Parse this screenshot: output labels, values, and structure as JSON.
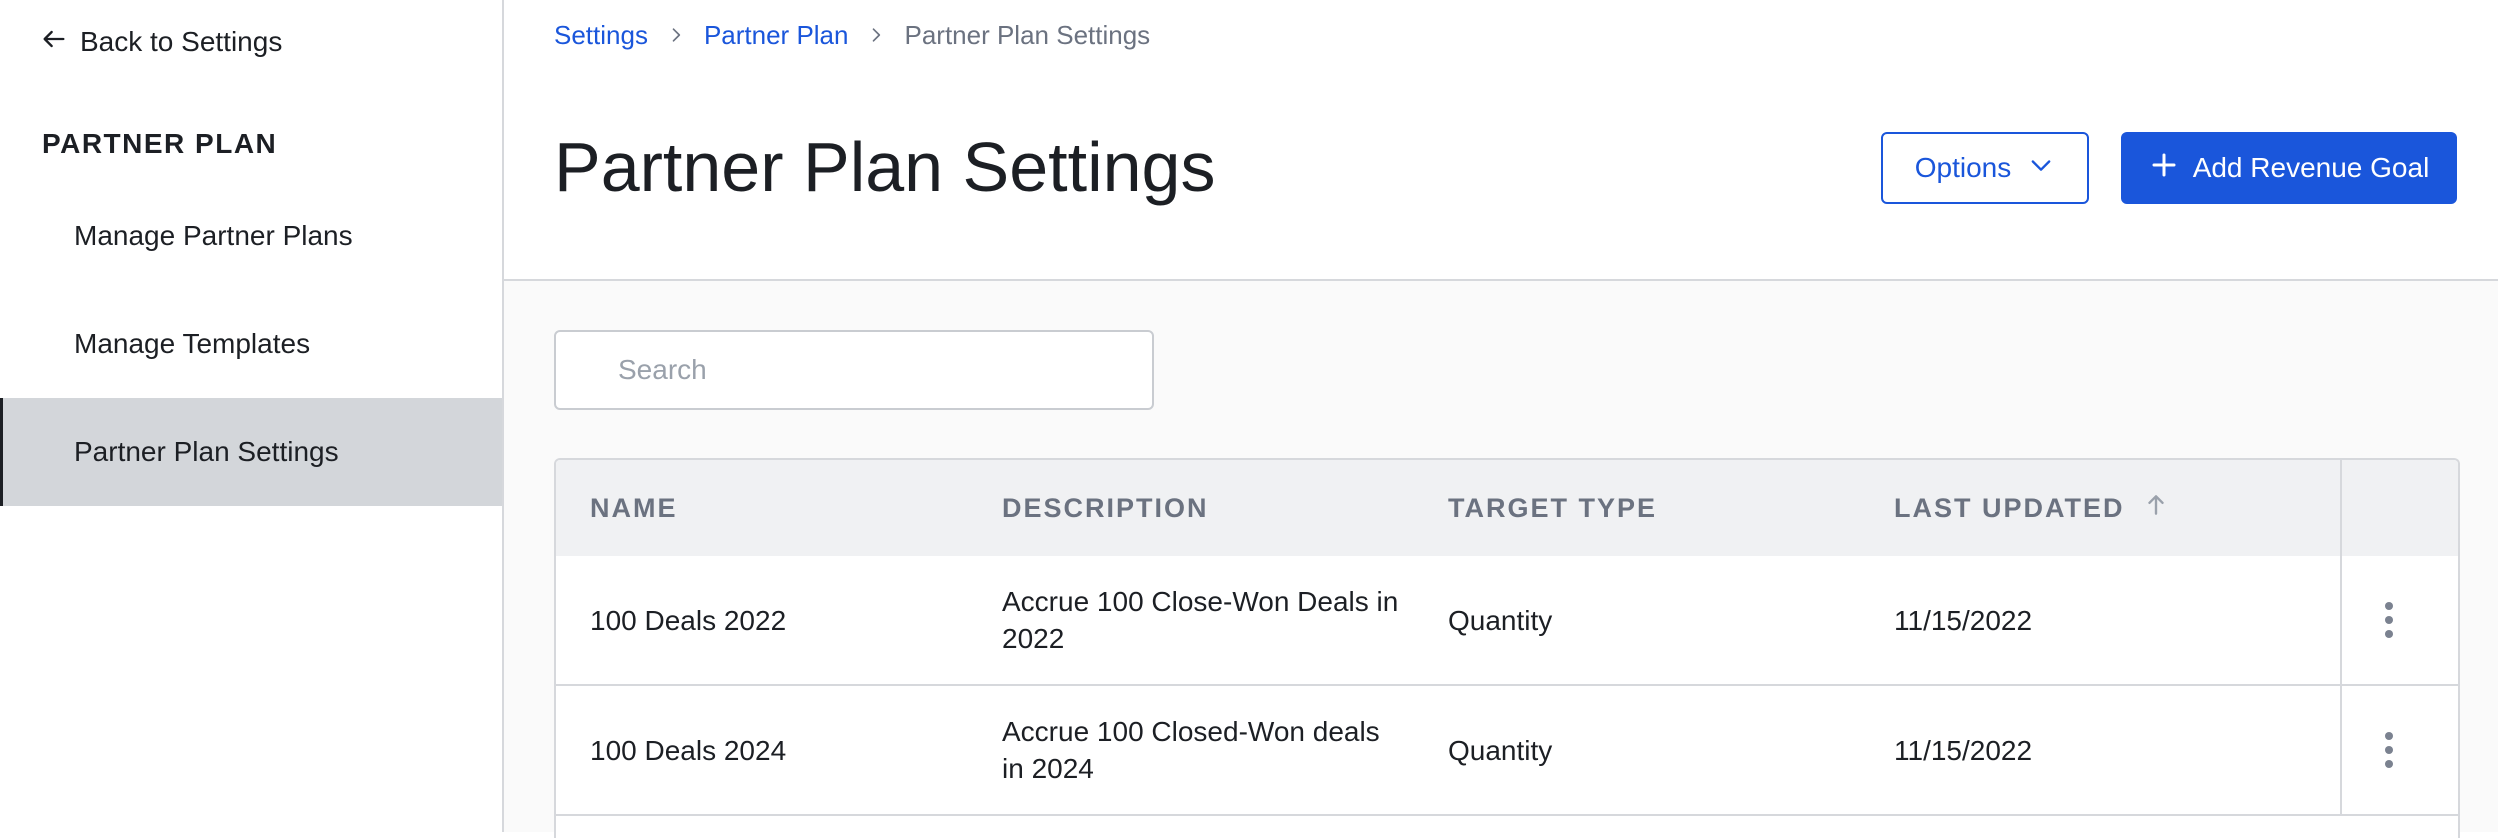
{
  "sidebar": {
    "back_label": "Back to Settings",
    "section_heading": "PARTNER PLAN",
    "items": [
      {
        "label": "Manage Partner Plans",
        "active": false
      },
      {
        "label": "Manage Templates",
        "active": false
      },
      {
        "label": "Partner Plan Settings",
        "active": true
      }
    ]
  },
  "breadcrumb": [
    "Settings",
    "Partner Plan",
    "Partner Plan Settings"
  ],
  "header": {
    "title": "Partner Plan Settings",
    "options_label": "Options",
    "add_label": "Add Revenue Goal"
  },
  "search": {
    "placeholder": "Search",
    "value": ""
  },
  "table": {
    "columns": [
      "NAME",
      "DESCRIPTION",
      "TARGET TYPE",
      "LAST UPDATED"
    ],
    "sort": {
      "column": "LAST UPDATED",
      "direction": "ascending"
    },
    "rows": [
      {
        "name": "100 Deals 2022",
        "description": "Accrue 100 Close-Won Deals in 2022",
        "target_type": "Quantity",
        "last_updated": "11/15/2022"
      },
      {
        "name": "100 Deals 2024",
        "description": "Accrue 100 Closed-Won deals in 2024",
        "target_type": "Quantity",
        "last_updated": "11/15/2022"
      }
    ]
  },
  "colors": {
    "accent": "#1a56db",
    "sidebar_active": "#d3d6da",
    "header_bg": "#f0f1f3",
    "muted_text": "#6b7280",
    "border": "#d6d8dc"
  },
  "icons": {
    "back": "arrow-left-icon",
    "breadcrumb_separator": "chevron-right-icon",
    "options": "chevron-down-icon",
    "add": "plus-icon",
    "sort": "arrow-up-icon",
    "row_menu": "kebab-menu-icon"
  }
}
